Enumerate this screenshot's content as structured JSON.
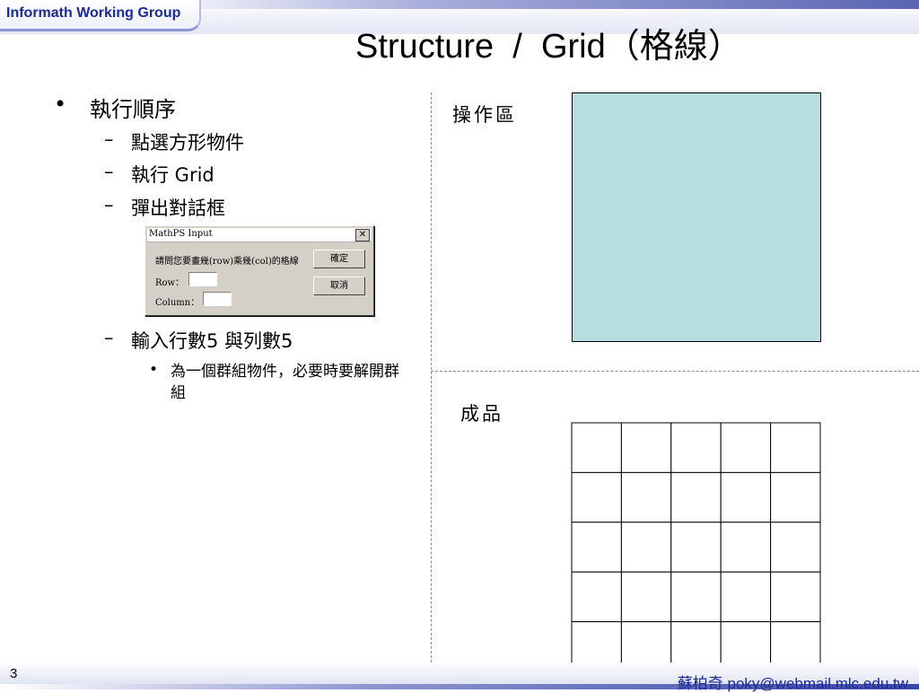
{
  "header": {
    "org": "Informath Working Group",
    "title": "Structure  /  Grid（格線）"
  },
  "bullets": {
    "main": "執行順序",
    "sub": [
      "點選方形物件",
      "執行 Grid",
      "彈出對話框"
    ],
    "sub4": "輸入行數5 與列數5",
    "note": "為一個群組物件，必要時要解開群組",
    "bullet_mark": "•",
    "dash_mark": "–"
  },
  "dialog": {
    "title": "MathPS Input",
    "close": "✕",
    "prompt": "請問您要畫幾(row)乘幾(col)的格線",
    "row_label": "Row：",
    "col_label": "Column：",
    "row_value": "",
    "col_value": "",
    "ok": "確定",
    "cancel": "取消"
  },
  "right": {
    "work_area_label": "操作區",
    "result_label": "成品",
    "work_rect_color": "#b7dde1",
    "grid_rows": 5,
    "grid_cols": 5
  },
  "footer": {
    "page": "3",
    "author": "蘇柏奇 poky@webmail.mlc.edu.tw"
  }
}
